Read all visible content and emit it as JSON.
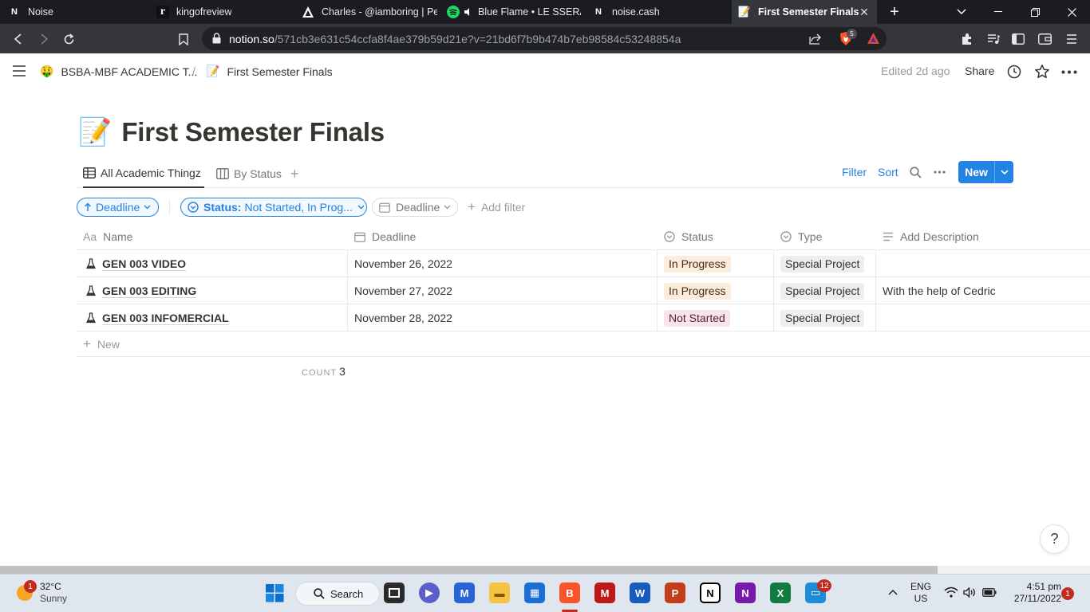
{
  "browser": {
    "tabs": [
      {
        "title": "Noise",
        "icon": "notion-icon"
      },
      {
        "title": "kingofreview",
        "icon": "r-icon"
      },
      {
        "title": "Charles - @iamboring | Pea",
        "icon": "arc-icon"
      },
      {
        "title": "Blue Flame • LE SSERAFIM",
        "icon": "spotify-icon"
      },
      {
        "title": "noise.cash",
        "icon": "notion-icon"
      },
      {
        "title": "First Semester Finals",
        "icon": "memo-icon"
      }
    ],
    "url_host": "notion.so",
    "url_path": "/571cb3e631c54ccfa8f4ae379b59d21e?v=21bd6f7b9b474b7eb98584c53248854a",
    "brave_badge": "5"
  },
  "topbar": {
    "workspace": "BSBA-MBF ACADEMIC T...",
    "separator": "/",
    "page": "First Semester Finals",
    "edited": "Edited 2d ago",
    "share": "Share"
  },
  "page": {
    "emoji": "📝",
    "title": "First Semester Finals"
  },
  "views": {
    "tab1": "All Academic Thingz",
    "tab2": "By Status",
    "filter": "Filter",
    "sort": "Sort",
    "new": "New"
  },
  "filters": {
    "sort_pill": "Deadline",
    "status_label": "Status:",
    "status_value": "Not Started, In Prog...",
    "deadline_pill": "Deadline",
    "add_filter": "Add filter"
  },
  "table": {
    "headers": {
      "name_prefix": "Aa",
      "name": "Name",
      "deadline": "Deadline",
      "status": "Status",
      "type": "Type",
      "description": "Add Description"
    },
    "rows": [
      {
        "name": "GEN 003 VIDEO",
        "deadline": "November 26, 2022",
        "status": "In Progress",
        "type": "Special Project",
        "description": ""
      },
      {
        "name": "GEN 003 EDITING",
        "deadline": "November 27, 2022",
        "status": "In Progress",
        "type": "Special Project",
        "description": "With the help of Cedric"
      },
      {
        "name": "GEN 003 INFOMERCIAL",
        "deadline": "November 28, 2022",
        "status": "Not Started",
        "type": "Special Project",
        "description": ""
      }
    ],
    "new_row": "New",
    "count_label": "COUNT",
    "count_value": "3"
  },
  "help": "?",
  "taskbar": {
    "weather_temp": "32°C",
    "weather_desc": "Sunny",
    "weather_badge": "1",
    "search": "Search",
    "teams_badge": "12",
    "lang_1": "ENG",
    "lang_2": "US",
    "time": "4:51 pm",
    "date": "27/11/2022",
    "notif_badge": "1"
  },
  "colors": {
    "accent": "#2383e2",
    "in_progress_bg": "#fbecdd",
    "in_progress_fg": "#49290e",
    "not_started_bg": "#f9e4ec",
    "not_started_fg": "#4c2337",
    "type_bg": "#eeeeec"
  }
}
